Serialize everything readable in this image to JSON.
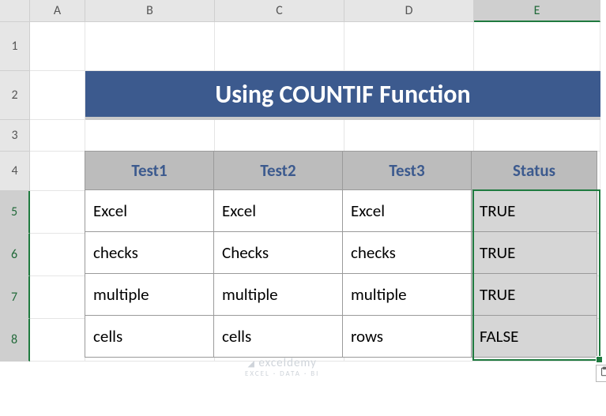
{
  "columns": [
    "A",
    "B",
    "C",
    "D",
    "E"
  ],
  "rows": [
    "1",
    "2",
    "3",
    "4",
    "5",
    "6",
    "7",
    "8"
  ],
  "active_column": "E",
  "title": "Using COUNTIF Function",
  "headers": {
    "b": "Test1",
    "c": "Test2",
    "d": "Test3",
    "e": "Status"
  },
  "data": [
    {
      "b": "Excel",
      "c": "Excel",
      "d": "Excel",
      "e": "TRUE"
    },
    {
      "b": "checks",
      "c": "Checks",
      "d": "checks",
      "e": "TRUE"
    },
    {
      "b": "multiple",
      "c": "multiple",
      "d": "multiple",
      "e": "TRUE"
    },
    {
      "b": "cells",
      "c": "cells",
      "d": "rows",
      "e": "FALSE"
    }
  ],
  "watermark": {
    "main": "exceldemy",
    "sub": "EXCEL · DATA · BI"
  },
  "chart_data": {
    "type": "table",
    "title": "Using COUNTIF Function",
    "columns": [
      "Test1",
      "Test2",
      "Test3",
      "Status"
    ],
    "rows": [
      [
        "Excel",
        "Excel",
        "Excel",
        "TRUE"
      ],
      [
        "checks",
        "Checks",
        "checks",
        "TRUE"
      ],
      [
        "multiple",
        "multiple",
        "multiple",
        "TRUE"
      ],
      [
        "cells",
        "cells",
        "rows",
        "FALSE"
      ]
    ]
  }
}
